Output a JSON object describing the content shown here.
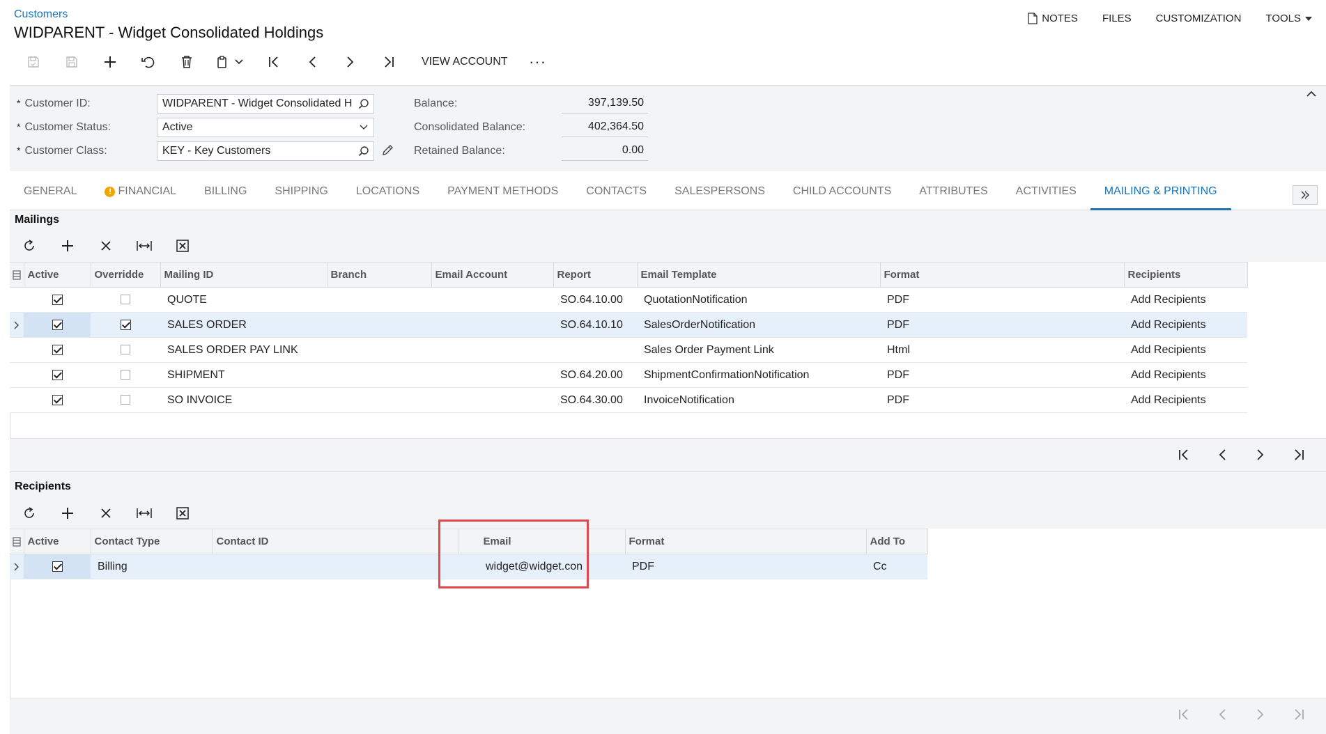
{
  "header": {
    "breadcrumb": "Customers",
    "title": "WIDPARENT - Widget Consolidated Holdings",
    "nav": {
      "notes": "NOTES",
      "files": "FILES",
      "customization": "CUSTOMIZATION",
      "tools": "TOOLS"
    }
  },
  "toolbar": {
    "view_account": "VIEW ACCOUNT",
    "more": "···"
  },
  "form": {
    "customer_id_label": "Customer ID:",
    "customer_id_value": "WIDPARENT - Widget Consolidated H",
    "customer_status_label": "Customer Status:",
    "customer_status_value": "Active",
    "customer_class_label": "Customer Class:",
    "customer_class_value": "KEY - Key Customers",
    "balance_label": "Balance:",
    "balance_value": "397,139.50",
    "consolidated_balance_label": "Consolidated Balance:",
    "consolidated_balance_value": "402,364.50",
    "retained_balance_label": "Retained Balance:",
    "retained_balance_value": "0.00",
    "required_mark": "*"
  },
  "tabs": [
    "GENERAL",
    "FINANCIAL",
    "BILLING",
    "SHIPPING",
    "LOCATIONS",
    "PAYMENT METHODS",
    "CONTACTS",
    "SALESPERSONS",
    "CHILD ACCOUNTS",
    "ATTRIBUTES",
    "ACTIVITIES",
    "MAILING & PRINTING"
  ],
  "active_tab": "MAILING & PRINTING",
  "mailings": {
    "title": "Mailings",
    "columns": [
      "Active",
      "Overridde",
      "Mailing ID",
      "Branch",
      "Email Account",
      "Report",
      "Email Template",
      "Format",
      "Recipients"
    ],
    "rows": [
      {
        "active": true,
        "override": false,
        "mailing_id": "QUOTE",
        "branch": "",
        "email_account": "",
        "report": "SO.64.10.00",
        "template": "QuotationNotification",
        "format": "PDF",
        "recipients": "Add Recipients"
      },
      {
        "active": true,
        "override": true,
        "mailing_id": "SALES ORDER",
        "branch": "",
        "email_account": "",
        "report": "SO.64.10.10",
        "template": "SalesOrderNotification",
        "format": "PDF",
        "recipients": "Add Recipients"
      },
      {
        "active": true,
        "override": false,
        "mailing_id": "SALES ORDER PAY LINK",
        "branch": "",
        "email_account": "",
        "report": "",
        "template": "Sales Order Payment Link",
        "format": "Html",
        "recipients": "Add Recipients"
      },
      {
        "active": true,
        "override": false,
        "mailing_id": "SHIPMENT",
        "branch": "",
        "email_account": "",
        "report": "SO.64.20.00",
        "template": "ShipmentConfirmationNotification",
        "format": "PDF",
        "recipients": "Add Recipients"
      },
      {
        "active": true,
        "override": false,
        "mailing_id": "SO INVOICE",
        "branch": "",
        "email_account": "",
        "report": "SO.64.30.00",
        "template": "InvoiceNotification",
        "format": "PDF",
        "recipients": "Add Recipients"
      }
    ]
  },
  "recipients": {
    "title": "Recipients",
    "columns": [
      "Active",
      "Contact Type",
      "Contact ID",
      "Email",
      "Format",
      "Add To"
    ],
    "rows": [
      {
        "active": true,
        "contact_type": "Billing",
        "contact_id": "",
        "email": "widget@widget.con",
        "format": "PDF",
        "add_to": "Cc"
      }
    ]
  }
}
